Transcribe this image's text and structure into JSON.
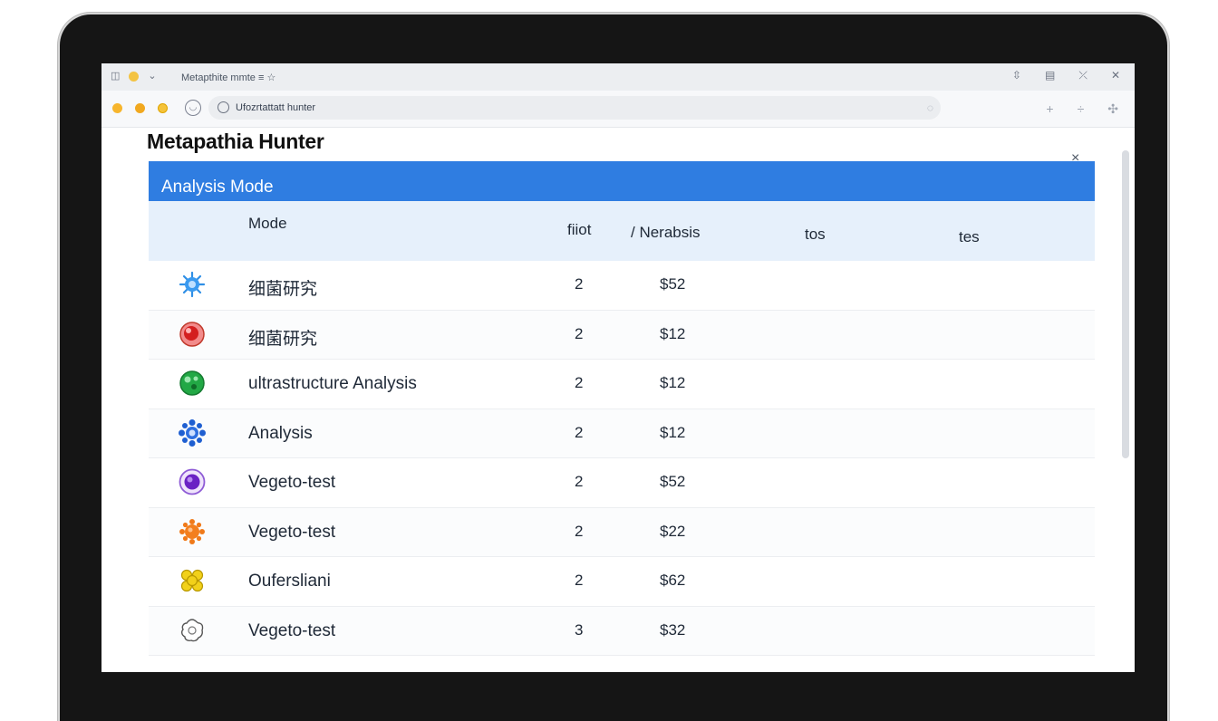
{
  "browser": {
    "tab_title": "Metapthite mmte ≡ ☆",
    "url": "Ufozrtattatt hunter",
    "tab_right_icons": [
      "⇳",
      "▤",
      "⤫",
      "✕"
    ],
    "toolbar_right_icons": [
      "+",
      "÷",
      "✣"
    ]
  },
  "app": {
    "title": "Metapathia Hunter",
    "close_icon": "×"
  },
  "panel": {
    "header": "Analysis Mode",
    "columns": {
      "mode": "Mode",
      "fiot": "fiiot",
      "nerabsis": "/ Nerabsis",
      "tos": "tos",
      "tes": "tes"
    },
    "rows": [
      {
        "icon": "blue-microbe-icon",
        "name": "细菌研究",
        "qty": "2",
        "price": "$52"
      },
      {
        "icon": "red-cell-icon",
        "name": "细菌研究",
        "qty": "2",
        "price": "$12"
      },
      {
        "icon": "green-cell-icon",
        "name": "ultrastructure Analysis",
        "qty": "2",
        "price": "$12"
      },
      {
        "icon": "blue-virus-icon",
        "name": "Analysis",
        "qty": "2",
        "price": "$12"
      },
      {
        "icon": "purple-cell-icon",
        "name": "Vegeto-test",
        "qty": "2",
        "price": "$52"
      },
      {
        "icon": "orange-microbe-icon",
        "name": "Vegeto-test",
        "qty": "2",
        "price": "$22"
      },
      {
        "icon": "yellow-cluster-icon",
        "name": "Oufersliani",
        "qty": "2",
        "price": "$62"
      },
      {
        "icon": "outline-cell-icon",
        "name": "Vegeto-test",
        "qty": "3",
        "price": "$32"
      }
    ]
  },
  "colors": {
    "header_blue": "#2f7de1",
    "column_head_bg": "#e6f0fb"
  }
}
